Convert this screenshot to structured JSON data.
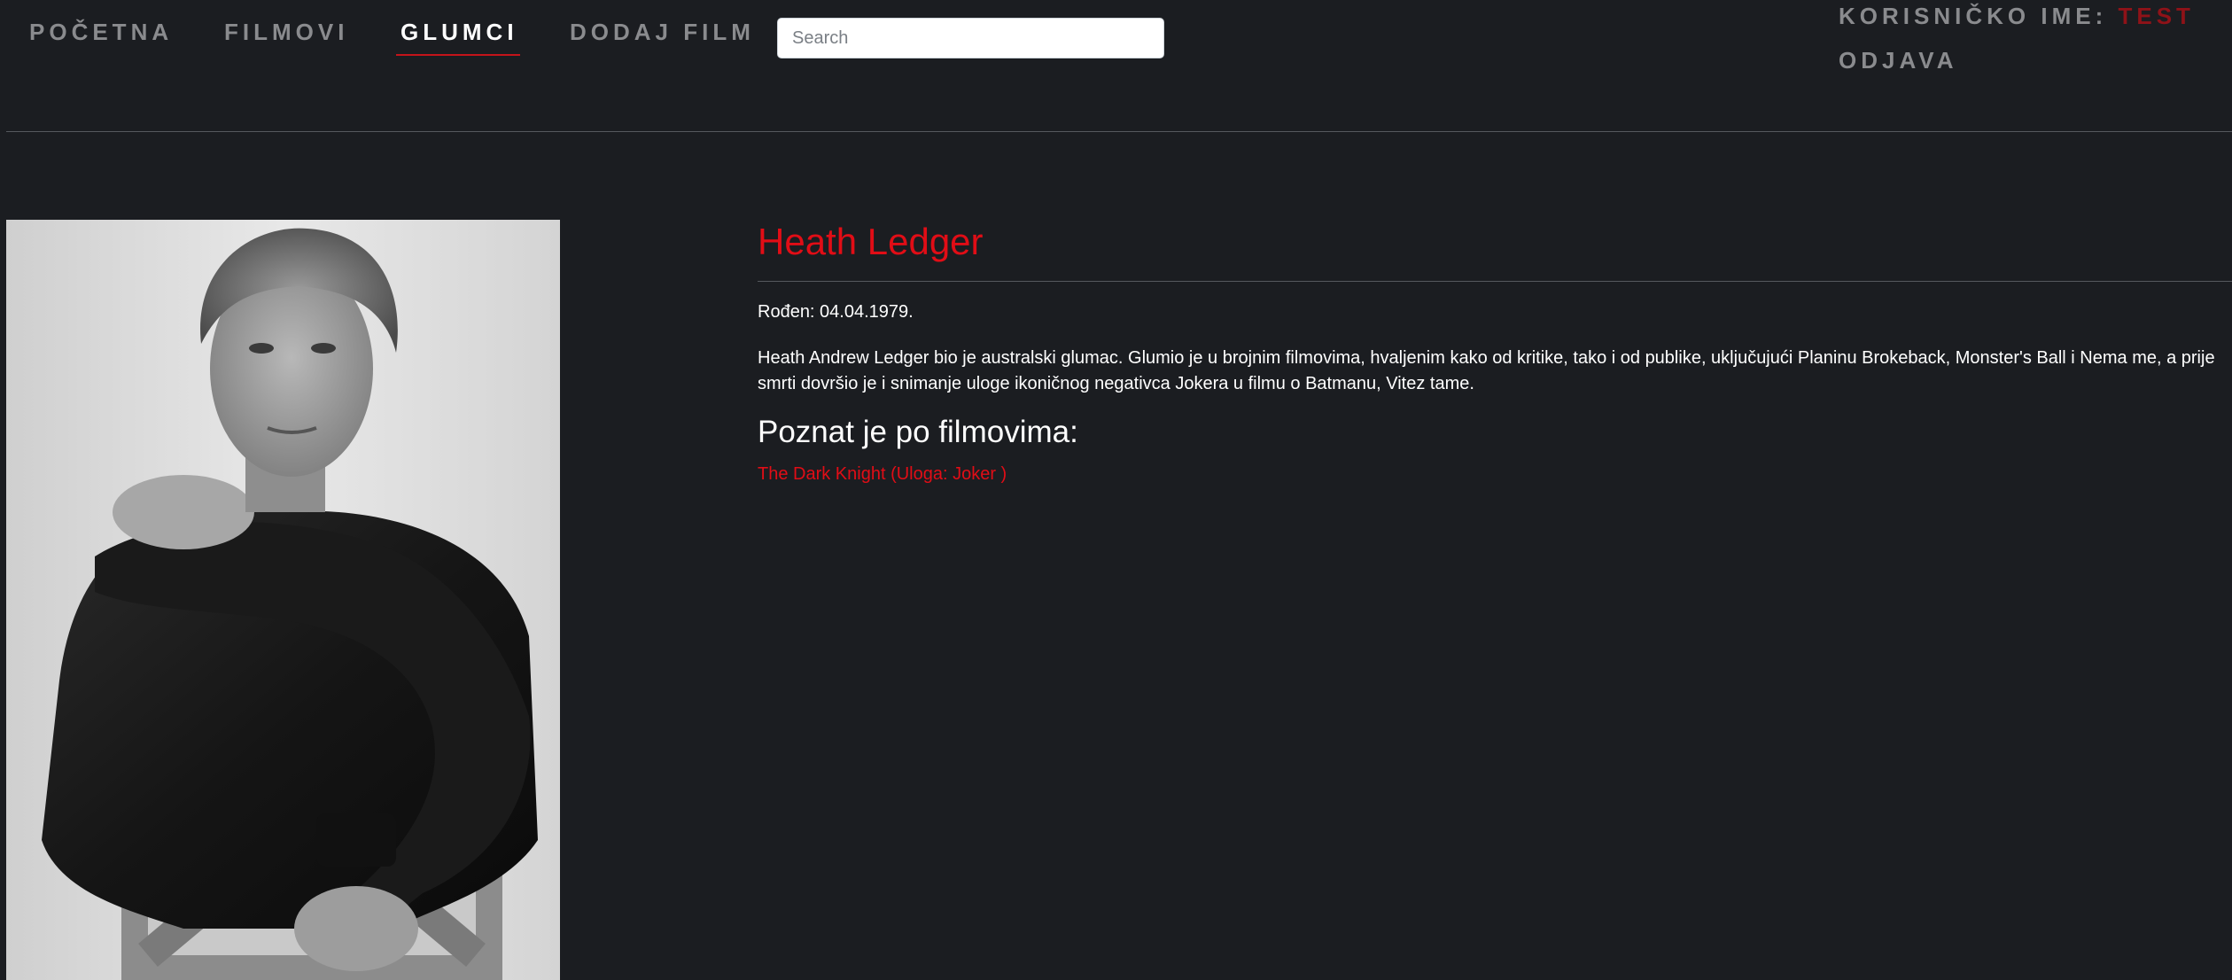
{
  "nav": {
    "home": "POČETNA",
    "films": "FILMOVI",
    "actors": "GLUMCI",
    "add_film": "DODAJ FILM"
  },
  "search": {
    "placeholder": "Search",
    "value": ""
  },
  "user": {
    "label": "KORISNIČKO IME:",
    "username": "TEST",
    "logout": "ODJAVA"
  },
  "actor": {
    "name": "Heath Ledger",
    "born": "Rođen: 04.04.1979.",
    "bio": "Heath Andrew Ledger bio je australski glumac. Glumio je u brojnim filmovima, hvaljenim kako od kritike, tako i od publike, uključujući Planinu Brokeback, Monster's Ball i Nema me, a prije smrti dovršio je i snimanje uloge ikoničnog negativca Jokera u filmu o Batmanu, Vitez tame.",
    "known_for_heading": "Poznat je po filmovima:",
    "films": [
      {
        "label": "The Dark Knight (Uloga: Joker )"
      }
    ]
  },
  "colors": {
    "background": "#1b1d21",
    "accent": "#e10d16",
    "nav_text": "#8a8b8e",
    "username": "#8f1218"
  }
}
